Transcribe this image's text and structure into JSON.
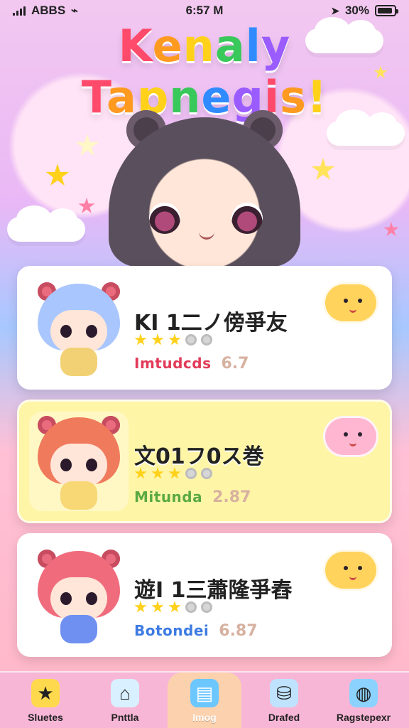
{
  "status_bar": {
    "carrier": "ABBS",
    "time": "6:57 M",
    "battery": "30%"
  },
  "header": {
    "title_line1": "Kenaly",
    "title_line2": "Tapnegis!"
  },
  "list": {
    "items": [
      {
        "name": "KI 1二ノ傍爭友",
        "rating": 3,
        "rating_max": 5,
        "genre": "Imtudcds",
        "score": "6.7",
        "theme": "white",
        "genre_color": "#e23b5a",
        "hair_color": "#a9c6ff",
        "body_color": "#f1d174",
        "sticker": "yellow-blob-icon"
      },
      {
        "name": "文01フ0ス巻",
        "rating": 3,
        "rating_max": 5,
        "genre": "Mitunda",
        "score": "2.87",
        "theme": "yellow",
        "genre_color": "#5aa943",
        "hair_color": "#f07a5c",
        "body_color": "#f7d875",
        "sticker": "pink-blob-icon"
      },
      {
        "name": "遊I 1三蕭隆爭舂",
        "rating": 3,
        "rating_max": 5,
        "genre": "Botondei",
        "score": "6.87",
        "theme": "white",
        "genre_color": "#3e7be2",
        "hair_color": "#f06c7c",
        "body_color": "#6f90f1",
        "sticker": "yellow-blob-icon"
      }
    ]
  },
  "tabbar": {
    "tabs": [
      {
        "label": "Sluetes",
        "icon": "star-icon"
      },
      {
        "label": "Pnttla",
        "icon": "home-icon"
      },
      {
        "label": "Imog",
        "icon": "book-icon",
        "active": true
      },
      {
        "label": "Drafed",
        "icon": "jar-icon"
      },
      {
        "label": "Ragstepexr",
        "icon": "pacifier-icon"
      }
    ]
  },
  "colors": {
    "tab_bar": "#f8b6d6",
    "active_tab": "#ffe88c",
    "star_gold": "#ffd11a"
  }
}
